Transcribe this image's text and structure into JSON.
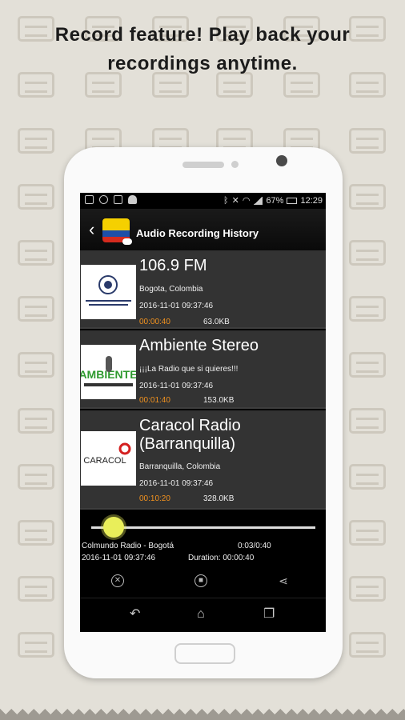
{
  "headline": {
    "line1": "Record feature! Play back your",
    "line2": "recordings anytime."
  },
  "statusbar": {
    "battery": "67%",
    "time": "12:29"
  },
  "appbar": {
    "title": "Audio Recording History"
  },
  "recordings": [
    {
      "title": "106.9 FM",
      "subtitle": "Bogota, Colombia",
      "date": "2016-11-01 09:37:46",
      "duration": "00:00:40",
      "size": "63.0KB"
    },
    {
      "title": "Ambiente Stereo",
      "subtitle": "¡¡¡La Radio que si quieres!!!",
      "date": "2016-11-01 09:37:46",
      "duration": "00:01:40",
      "size": "153.0KB",
      "logo_text": "AMBIENTE"
    },
    {
      "title": "Caracol Radio (Barranquilla)",
      "subtitle": "Barranquilla, Colombia",
      "date": "2016-11-01 09:37:46",
      "duration": "00:10:20",
      "size": "328.0KB",
      "logo_text": "CARACOL"
    }
  ],
  "player": {
    "station": "Colmundo Radio - Bogotá",
    "position": "0:03/0:40",
    "date": "2016-11-01 09:37:46",
    "duration": "Duration: 00:00:40",
    "progress": 0.1
  },
  "colors": {
    "accent_orange": "#f2921f",
    "seek_thumb": "#e9ee5a"
  },
  "icons": [
    "close-circle-icon",
    "stop-icon",
    "share-icon",
    "back-nav-icon",
    "home-nav-icon",
    "recents-nav-icon"
  ]
}
